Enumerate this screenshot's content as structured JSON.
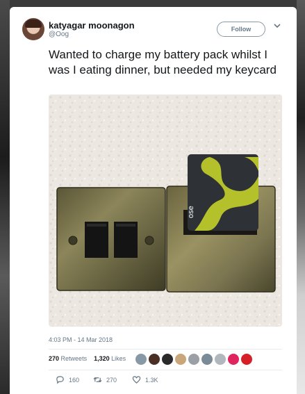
{
  "tweet": {
    "author_name": "katyagar moonagon",
    "author_handle": "@Oog",
    "follow_label": "Follow",
    "text": "Wanted to charge my battery pack whilst I was I eating dinner, but needed my keycard",
    "timestamp": "4:03 PM - 14 Mar 2018"
  },
  "stats": {
    "retweets_count": "270",
    "retweets_label": "Retweets",
    "likes_count": "1,320",
    "likes_label": "Likes"
  },
  "actions": {
    "reply_count": "160",
    "retweet_count": "270",
    "like_count": "1.3K"
  },
  "photo": {
    "keycard_text": "ose"
  },
  "icons": [
    "chevron-down-icon",
    "reply-icon",
    "retweet-icon",
    "heart-icon"
  ],
  "colors": {
    "card_bg": "#ffffff",
    "secondary_text": "#657786",
    "keycard_lime": "#b5c12b",
    "keycard_dark": "#2e3135"
  }
}
